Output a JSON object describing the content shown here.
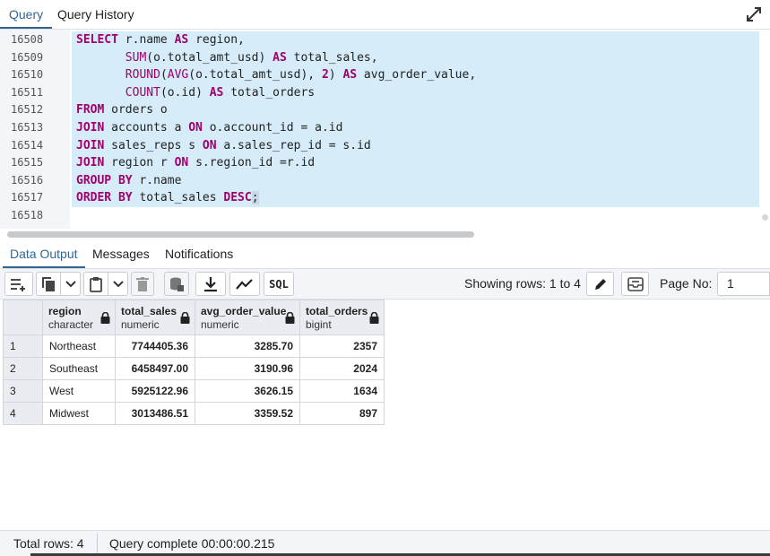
{
  "top_tabs": [
    {
      "label": "Query",
      "active": true
    },
    {
      "label": "Query History",
      "active": false
    }
  ],
  "editor": {
    "line_numbers": [
      "16508",
      "16509",
      "16510",
      "16511",
      "16512",
      "16513",
      "16514",
      "16515",
      "16516",
      "16517",
      "16518"
    ],
    "lines": [
      [
        {
          "t": "SELECT",
          "c": "kw"
        },
        {
          "t": " r.name "
        },
        {
          "t": "AS",
          "c": "kw"
        },
        {
          "t": " region,"
        }
      ],
      [
        {
          "t": "       "
        },
        {
          "t": "SUM",
          "c": "fn"
        },
        {
          "t": "(o.total_amt_usd) "
        },
        {
          "t": "AS",
          "c": "kw"
        },
        {
          "t": " total_sales,"
        }
      ],
      [
        {
          "t": "       "
        },
        {
          "t": "ROUND",
          "c": "fn"
        },
        {
          "t": "("
        },
        {
          "t": "AVG",
          "c": "fn"
        },
        {
          "t": "(o.total_amt_usd), "
        },
        {
          "t": "2",
          "c": "num"
        },
        {
          "t": ") "
        },
        {
          "t": "AS",
          "c": "kw"
        },
        {
          "t": " avg_order_value,"
        }
      ],
      [
        {
          "t": "       "
        },
        {
          "t": "COUNT",
          "c": "fn"
        },
        {
          "t": "(o.id) "
        },
        {
          "t": "AS",
          "c": "kw"
        },
        {
          "t": " total_orders"
        }
      ],
      [
        {
          "t": "FROM",
          "c": "kw"
        },
        {
          "t": " orders o"
        }
      ],
      [
        {
          "t": "JOIN",
          "c": "kw"
        },
        {
          "t": " accounts a "
        },
        {
          "t": "ON",
          "c": "kw"
        },
        {
          "t": " o.account_id = a.id"
        }
      ],
      [
        {
          "t": "JOIN",
          "c": "kw"
        },
        {
          "t": " sales_reps s "
        },
        {
          "t": "ON",
          "c": "kw"
        },
        {
          "t": " a.sales_rep_id = s.id"
        }
      ],
      [
        {
          "t": "JOIN",
          "c": "kw"
        },
        {
          "t": " region r "
        },
        {
          "t": "ON",
          "c": "kw"
        },
        {
          "t": " s.region_id =r.id"
        }
      ],
      [
        {
          "t": "GROUP BY",
          "c": "kw"
        },
        {
          "t": " r.name"
        }
      ],
      [
        {
          "t": "ORDER BY",
          "c": "kw"
        },
        {
          "t": " total_sales "
        },
        {
          "t": "DESC",
          "c": "kw"
        },
        {
          "t": ";",
          "c": "caret-sel"
        }
      ],
      []
    ]
  },
  "result_tabs": [
    {
      "label": "Data Output",
      "active": true
    },
    {
      "label": "Messages",
      "active": false
    },
    {
      "label": "Notifications",
      "active": false
    }
  ],
  "toolbar": {
    "sql_label": "SQL",
    "showing_rows": "Showing rows: 1 to 4",
    "page_label": "Page No:",
    "page_value": "1",
    "icons": [
      "add-row-icon",
      "copy-icon",
      "chevron-down-icon",
      "paste-icon",
      "chevron-down-icon",
      "delete-icon",
      "save-data-icon",
      "download-icon",
      "graph-icon",
      "sql-icon",
      "edit-icon",
      "filter-rows-icon"
    ]
  },
  "grid": {
    "columns": [
      {
        "name": "region",
        "type": "character"
      },
      {
        "name": "total_sales",
        "type": "numeric"
      },
      {
        "name": "avg_order_value",
        "type": "numeric"
      },
      {
        "name": "total_orders",
        "type": "bigint"
      }
    ],
    "rows": [
      {
        "n": "1",
        "cells": [
          "Northeast",
          "7744405.36",
          "3285.70",
          "2357"
        ]
      },
      {
        "n": "2",
        "cells": [
          "Southeast",
          "6458497.00",
          "3190.96",
          "2024"
        ]
      },
      {
        "n": "3",
        "cells": [
          "West",
          "5925122.96",
          "3626.15",
          "1634"
        ]
      },
      {
        "n": "4",
        "cells": [
          "Midwest",
          "3013486.51",
          "3359.52",
          "897"
        ]
      }
    ]
  },
  "status": {
    "total_rows": "Total rows: 4",
    "query_complete": "Query complete 00:00:00.215"
  },
  "colors": {
    "accent": "#326690",
    "keyword": "#a0006b",
    "selection": "#d6ecf9"
  }
}
